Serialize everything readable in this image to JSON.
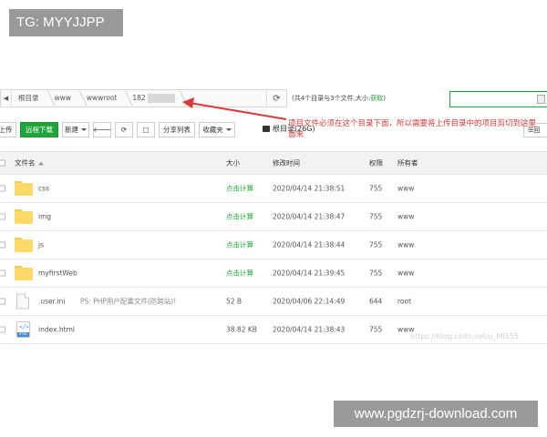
{
  "overlay": {
    "tg_label": "TG: MYYJJPP",
    "watermark": "www.pgdzrj-download.com",
    "faint_watermark": "https://blog.csdn.net/u_Mi555"
  },
  "breadcrumb": {
    "back_icon": "back-triangle-icon",
    "items": [
      "根目录",
      "www",
      "wwwroot",
      "182"
    ],
    "refresh_icon": "refresh-icon"
  },
  "summary": {
    "text": "(共4个目录与3个文件,大小:",
    "link": "获取",
    "close": ")"
  },
  "search": {
    "placeholder": ""
  },
  "toolbar": {
    "upload": "上传",
    "remote_download": "远程下载",
    "new": "新建",
    "back_icon": "arrow-left-icon",
    "refresh_icon": "refresh-icon",
    "terminal_icon": "terminal-icon",
    "share_list": "分享列表",
    "favorites": "收藏夹",
    "root_dir": "根目录(26G)",
    "right_btn": "回"
  },
  "annotation": {
    "text": "项目文件必须在这个目录下面，所以需要将上传目录中的项目剪切到这里面来",
    "color": "#d83a3a"
  },
  "table": {
    "headers": {
      "name": "文件名",
      "size": "大小",
      "mtime": "修改时间",
      "perm": "权限",
      "owner": "所有者"
    },
    "rows": [
      {
        "type": "folder",
        "name": "css",
        "size": "点击计算",
        "mtime": "2020/04/14 21:38:51",
        "perm": "755",
        "owner": "www",
        "note": ""
      },
      {
        "type": "folder",
        "name": "img",
        "size": "点击计算",
        "mtime": "2020/04/14 21:38:47",
        "perm": "755",
        "owner": "www",
        "note": ""
      },
      {
        "type": "folder",
        "name": "js",
        "size": "点击计算",
        "mtime": "2020/04/14 21:38:44",
        "perm": "755",
        "owner": "www",
        "note": ""
      },
      {
        "type": "folder",
        "name": "myfirstWeb",
        "size": "点击计算",
        "mtime": "2020/04/14 21:39:45",
        "perm": "755",
        "owner": "www",
        "note": ""
      },
      {
        "type": "file",
        "name": ".user.ini",
        "size": "52 B",
        "mtime": "2020/04/06 22:14:49",
        "perm": "644",
        "owner": "root",
        "note": "PS: PHP用户配置文件(防跨站)!"
      },
      {
        "type": "html",
        "name": "index.html",
        "size": "38.82 KB",
        "mtime": "2020/04/14 21:38:43",
        "perm": "755",
        "owner": "www",
        "note": ""
      }
    ]
  },
  "colors": {
    "accent": "#20a53a",
    "annotation": "#d83a3a",
    "folder": "#fcd968"
  }
}
